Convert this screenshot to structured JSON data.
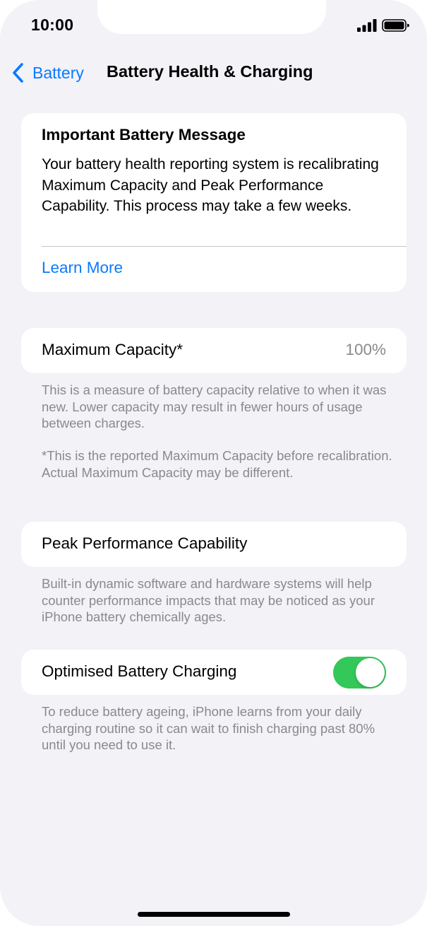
{
  "status_bar": {
    "time": "10:00",
    "icons": [
      "signal-icon",
      "battery-icon"
    ]
  },
  "nav": {
    "back_label": "Battery",
    "title": "Battery Health & Charging",
    "back_icon": "chevron-left-icon"
  },
  "message_card": {
    "title": "Important Battery Message",
    "body": "Your battery health reporting system is recalibrating Maximum Capacity and Peak Performance Capability. This process may take a few weeks.",
    "link": "Learn More"
  },
  "maximum_capacity": {
    "label": "Maximum Capacity*",
    "value": "100%",
    "footnote_1": "This is a measure of battery capacity relative to when it was new. Lower capacity may result in fewer hours of usage between charges.",
    "footnote_2": "*This is the reported Maximum Capacity before recalibration. Actual Maximum Capacity may be different."
  },
  "peak_performance": {
    "label": "Peak Performance Capability",
    "footnote": "Built-in dynamic software and hardware systems will help counter performance impacts that may be noticed as your iPhone battery chemically ages."
  },
  "optimised_charging": {
    "label": "Optimised Battery Charging",
    "enabled": true,
    "footnote": "To reduce battery ageing, iPhone learns from your daily charging routine so it can wait to finish charging past 80% until you need to use it."
  },
  "colors": {
    "accent": "#0a7aff",
    "toggle_on": "#34c759",
    "background": "#f2f2f7",
    "secondary_text": "#8a8a8e"
  }
}
